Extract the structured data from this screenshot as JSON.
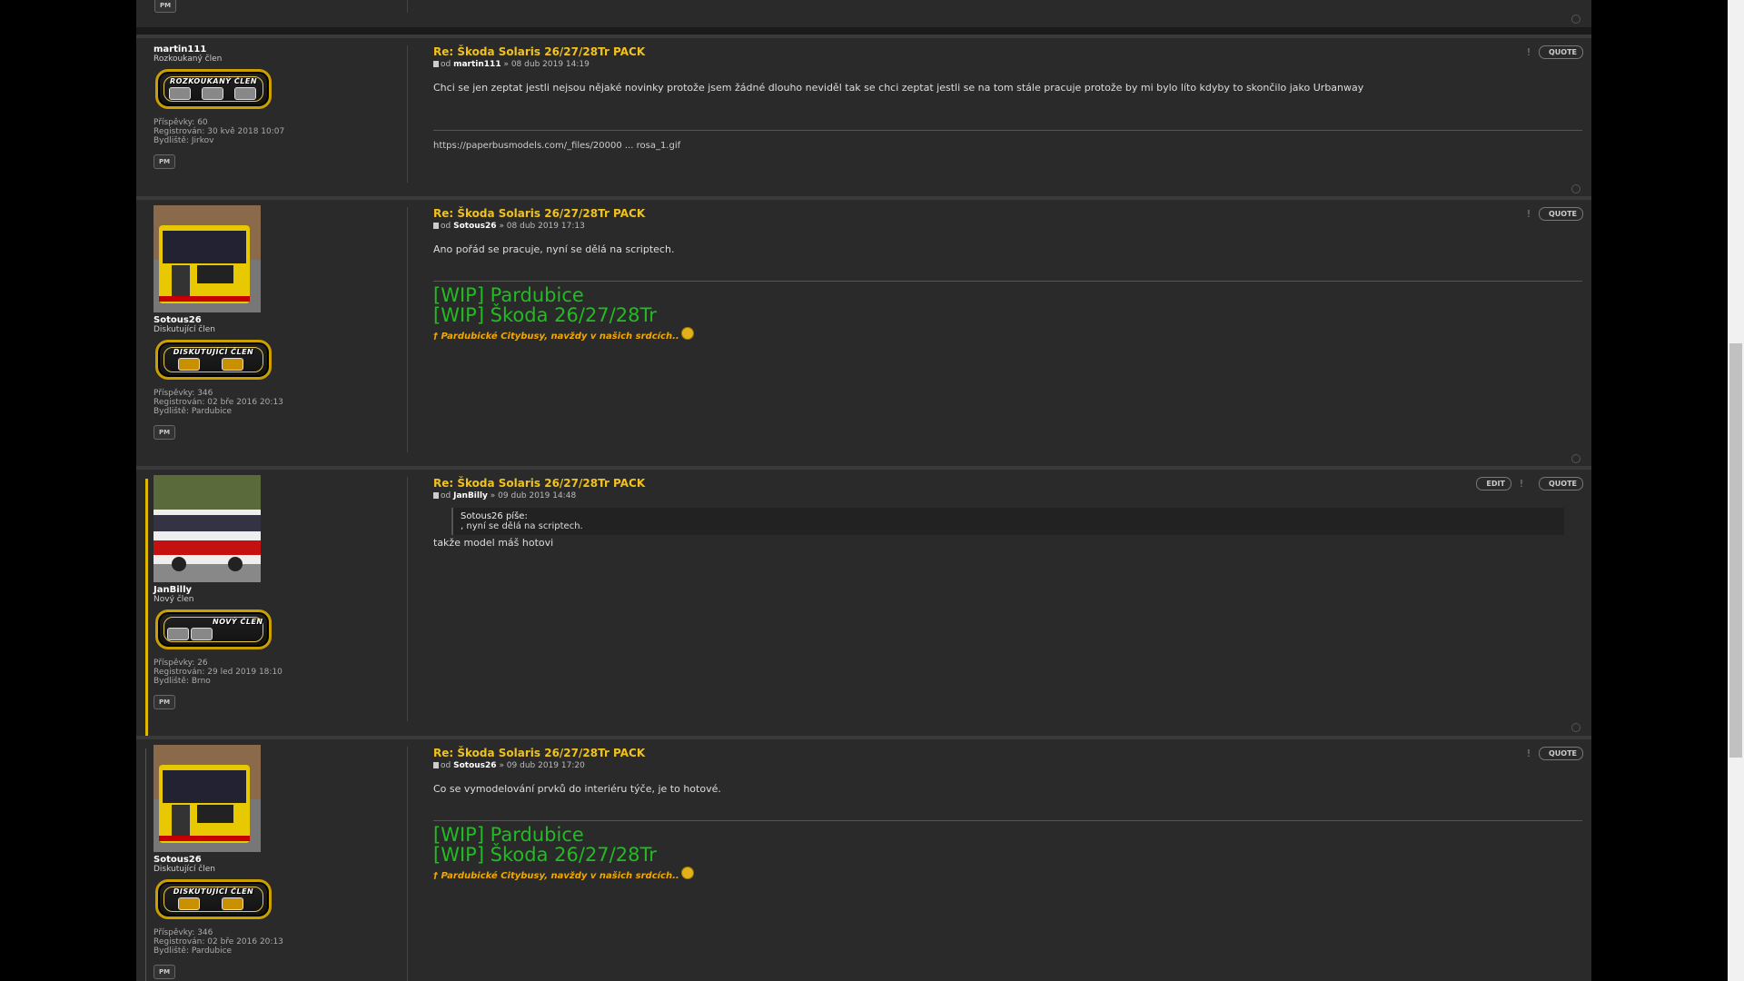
{
  "actions": {
    "quote_label": "QUOTE",
    "edit_label": "EDIT",
    "pm_label": "PM"
  },
  "posts": [
    {
      "user": "martin111",
      "rank": "Rozkoukaný člen",
      "badge": "ROZKOUKANÝ ČLEN",
      "posts_label": "Příspěvky: 60",
      "registered": "Registrován: 30 kvě 2018 10:07",
      "location": "Bydliště: Jirkov",
      "title": "Re: Škoda Solaris 26/27/28Tr PACK",
      "by": "od",
      "date": "» 08 dub 2019 14:19",
      "body": "Chci se jen zeptat jestli nejsou nějaké novinky protože jsem žádné dlouho neviděl tak se chci zeptat jestli se na tom stále pracuje protože by mi bylo líto kdyby to skončilo jako Urbanway",
      "sig_link": "https://paperbusmodels.com/_files/20000 ... rosa_1.gif"
    },
    {
      "user": "Sotous26",
      "rank": "Diskutující člen",
      "badge": "DISKUTUJÍCÍ ČLEN",
      "posts_label": "Příspěvky: 346",
      "registered": "Registrován: 02 bře 2016 20:13",
      "location": "Bydliště: Pardubice",
      "title": "Re: Škoda Solaris 26/27/28Tr PACK",
      "by": "od",
      "date": "» 08 dub 2019 17:13",
      "body": "Ano pořád se pracuje, nyní se dělá na scriptech.",
      "sig1": "[WIP] Pardubice",
      "sig2": "[WIP] Škoda 26/27/28Tr",
      "sig3": "† Pardubické Citybusy, navždy v našich srdcích.."
    },
    {
      "user": "JanBilly",
      "rank": "Nový člen",
      "badge": "NOVÝ ČLEN",
      "posts_label": "Příspěvky: 26",
      "registered": "Registrován: 29 led 2019 18:10",
      "location": "Bydliště: Brno",
      "title": "Re: Škoda Solaris 26/27/28Tr PACK",
      "by": "od",
      "date": "» 09 dub 2019 14:48",
      "quote_head": "Sotous26 píše:",
      "quote_text": ", nyní se dělá na scriptech.",
      "body": "takže model máš hotovi"
    },
    {
      "user": "Sotous26",
      "rank": "Diskutující člen",
      "badge": "DISKUTUJÍCÍ ČLEN",
      "posts_label": "Příspěvky: 346",
      "registered": "Registrován: 02 bře 2016 20:13",
      "location": "Bydliště: Pardubice",
      "title": "Re: Škoda Solaris 26/27/28Tr PACK",
      "by": "od",
      "date": "» 09 dub 2019 17:20",
      "body": "Co se vymodelování prvků do interiéru týče, je to hotové.",
      "sig1": "[WIP] Pardubice",
      "sig2": "[WIP] Škoda 26/27/28Tr",
      "sig3": "† Pardubické Citybusy, navždy v našich srdcích.."
    }
  ],
  "colors": {
    "title": "#f1c21b",
    "wip": "#22bb22",
    "highlight": "#e0b800",
    "background": "#1a1a1a",
    "post": "#2a2a2a"
  }
}
